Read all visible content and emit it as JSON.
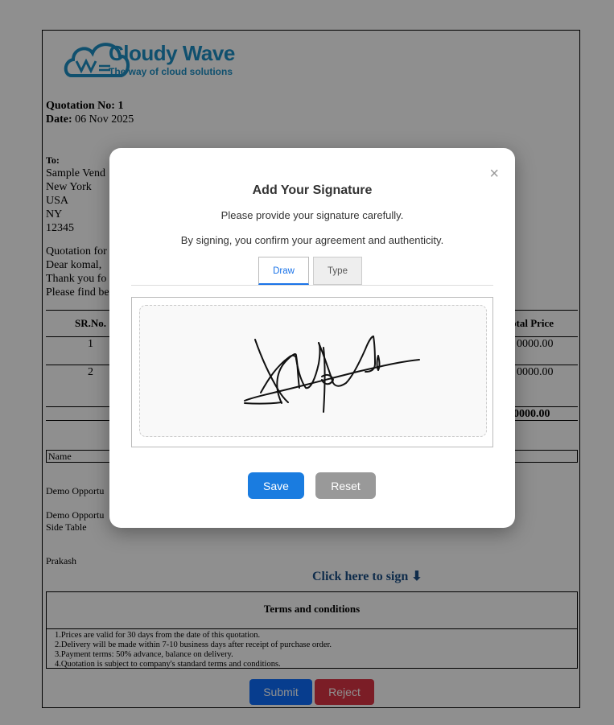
{
  "company": {
    "name": "Cloudy Wave",
    "tagline": "The way of cloud solutions",
    "logo_text": "WAVE"
  },
  "quotation": {
    "no_label": "Quotation No:",
    "no_value": "1",
    "date_label": "Date:",
    "date_value": "06 Nov 2025",
    "to_label": "To:",
    "address": [
      "Sample Vend",
      "New York",
      "USA",
      "NY",
      "12345"
    ],
    "lines": [
      "Quotation for",
      "Dear komal,",
      "Thank you fo",
      "Please find be"
    ]
  },
  "table": {
    "col_sr": "SR.No.",
    "col_total": "otal Price",
    "rows": [
      {
        "sr": "1",
        "total": "0000.00"
      },
      {
        "sr": "2",
        "total": "0000.00"
      }
    ],
    "grand_total": "0000.00"
  },
  "name_label": "Name",
  "items": [
    "Demo Opportu",
    "Demo Opportu",
    "Side Table",
    "Prakash"
  ],
  "sign_link": "Click here to sign",
  "sign_arrow": "⬇",
  "terms": {
    "title": "Terms and conditions",
    "items": [
      "1.Prices are valid for 30 days from the date of this quotation.",
      "2.Delivery will be made within 7-10 business days after receipt of purchase order.",
      "3.Payment terms: 50% advance, balance on delivery.",
      "4.Quotation is subject to company's standard terms and conditions."
    ]
  },
  "doc_buttons": {
    "submit": "Submit",
    "reject": "Reject"
  },
  "modal": {
    "close": "×",
    "title": "Add Your Signature",
    "subtitle": "Please provide your signature carefully.",
    "note": "By signing, you confirm your agreement and authenticity.",
    "tabs": [
      {
        "label": "Draw"
      },
      {
        "label": "Type"
      }
    ],
    "save": "Save",
    "reset": "Reset"
  },
  "colors": {
    "brand": "#1d8fc4",
    "primary": "#1a7ce0",
    "danger": "#dc3545",
    "link": "#1b4f86"
  }
}
